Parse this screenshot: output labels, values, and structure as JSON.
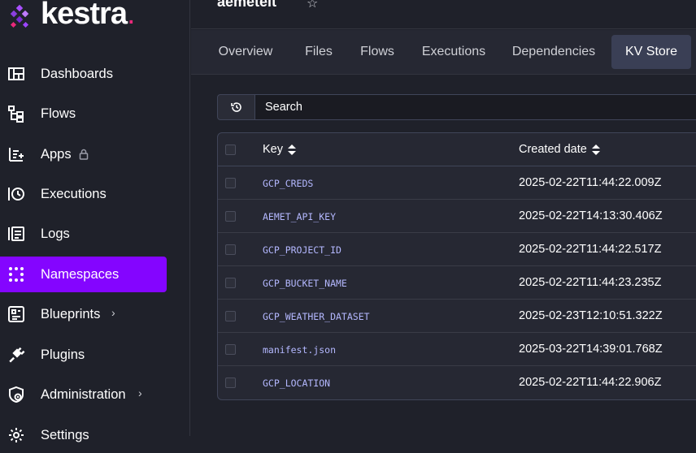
{
  "brand": {
    "name": "kestra",
    "dot": "."
  },
  "sidebar": {
    "items": [
      {
        "label": "Dashboards",
        "icon": "dashboard-icon"
      },
      {
        "label": "Flows",
        "icon": "flows-icon"
      },
      {
        "label": "Apps",
        "icon": "apps-icon",
        "locked": true
      },
      {
        "label": "Executions",
        "icon": "executions-icon"
      },
      {
        "label": "Logs",
        "icon": "logs-icon"
      },
      {
        "label": "Namespaces",
        "icon": "namespaces-icon",
        "active": true
      },
      {
        "label": "Blueprints",
        "icon": "blueprints-icon",
        "chevron": "›"
      },
      {
        "label": "Plugins",
        "icon": "plugins-icon"
      },
      {
        "label": "Administration",
        "icon": "administration-icon",
        "chevron": "›"
      },
      {
        "label": "Settings",
        "icon": "settings-icon"
      }
    ]
  },
  "header": {
    "title": "aemetelt",
    "star": "☆"
  },
  "tabs": [
    {
      "label": "Overview"
    },
    {
      "label": "Files"
    },
    {
      "label": "Flows"
    },
    {
      "label": "Executions"
    },
    {
      "label": "Dependencies"
    },
    {
      "label": "KV Store",
      "active": true
    }
  ],
  "search": {
    "placeholder": "Search"
  },
  "table": {
    "columns": {
      "key": "Key",
      "created": "Created date"
    },
    "rows": [
      {
        "key": "GCP_CREDS",
        "created": "2025-02-22T11:44:22.009Z"
      },
      {
        "key": "AEMET_API_KEY",
        "created": "2025-02-22T14:13:30.406Z"
      },
      {
        "key": "GCP_PROJECT_ID",
        "created": "2025-02-22T11:44:22.517Z"
      },
      {
        "key": "GCP_BUCKET_NAME",
        "created": "2025-02-22T11:44:23.235Z"
      },
      {
        "key": "GCP_WEATHER_DATASET",
        "created": "2025-02-23T12:10:51.322Z"
      },
      {
        "key": "manifest.json",
        "created": "2025-03-22T14:39:01.768Z"
      },
      {
        "key": "GCP_LOCATION",
        "created": "2025-02-22T11:44:22.906Z"
      }
    ]
  },
  "colors": {
    "accent": "#8405ff",
    "background": "#1f212a",
    "key_text": "#b4b8ff",
    "brand_dot": "#e9297a"
  }
}
